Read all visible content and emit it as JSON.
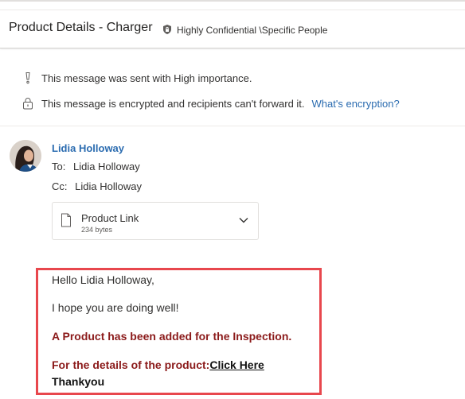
{
  "header": {
    "subject": "Product Details - Charger",
    "sensitivity_icon": "shield-lock-icon",
    "sensitivity_label": "Highly Confidential \\Specific People"
  },
  "infobar": {
    "importance_icon": "exclamation-icon",
    "importance_text": "This message was sent with High importance.",
    "encryption_icon": "lock-icon",
    "encryption_text": "This message is encrypted and recipients can't forward it.",
    "encryption_link": "What's encryption?"
  },
  "message": {
    "sender": "Lidia Holloway",
    "to_label": "To:",
    "to_value": "Lidia Holloway",
    "cc_label": "Cc:",
    "cc_value": "Lidia Holloway"
  },
  "attachment": {
    "icon": "file-icon",
    "name": "Product Link",
    "size": "234 bytes",
    "chevron": "chevron-down-icon"
  },
  "body": {
    "greeting": "Hello Lidia Holloway,",
    "line1": "I hope you are doing well!",
    "line2": "A Product has been added for the Inspection.",
    "line3_prefix": "For the details of the product:",
    "line3_link": "Click Here",
    "signoff": "Thankyou"
  },
  "colors": {
    "link": "#2b6cb0",
    "body_red": "#8b1a1a",
    "highlight_border": "#e8474d"
  }
}
